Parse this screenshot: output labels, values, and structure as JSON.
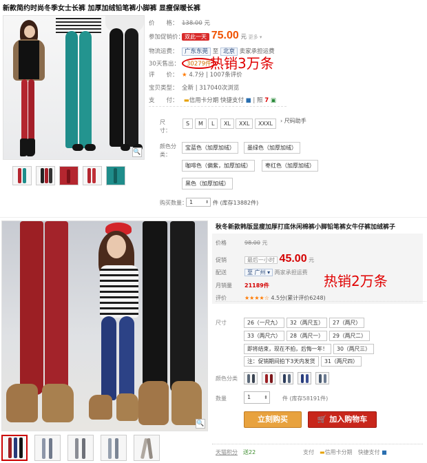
{
  "top": {
    "title": "新款简约时尚冬季女士长裤 加厚加绒铅笔裤小脚裤 显瘦保暖长裤",
    "price_label": "价　　格：",
    "price": "138.00",
    "price_unit": "元",
    "promo_label": "参加促销价：",
    "promo_tag": "双此一天",
    "promo_price": "75.00",
    "promo_unit": "元",
    "promo_more": "更多 ▾",
    "shipping_label": "物流运费：",
    "shipping_from": "广东东莞",
    "shipping_to_word": "至",
    "shipping_to": "北京",
    "shipping_note": "卖家承担运费",
    "sold_label": "30天售出：",
    "sold_count": "30279",
    "sold_unit": "件",
    "rating_label": "评　　价：",
    "rating_score": "4.7分",
    "reviews": "1007条评价",
    "type_label": "宝贝类型：",
    "type_value": "全新",
    "views": "317040次浏览",
    "pay_label": "支　　付：",
    "pay_items": [
      "信用卡分期",
      "快捷支付",
      "照"
    ],
    "size_label": "尺　　寸：",
    "sizes": [
      "S",
      "M",
      "L",
      "XL",
      "XXL",
      "XXXL"
    ],
    "size_chart": "尺码助手",
    "color_label": "颜色分类：",
    "colors": [
      "宝蓝色（加厚加绒）",
      "墨绿色（加厚加绒）",
      "咖啡色（偏紫，加厚加绒）",
      "枣红色（加厚加绒）",
      "黑色（加厚加绒）"
    ],
    "qty_label": "购买数量：",
    "qty_value": "1",
    "qty_unit": "件",
    "stock": "(库存13882件)",
    "hot_note": "热销3万条",
    "zoom_icon": "🔍"
  },
  "bottom": {
    "title": "秋冬新款韩版显瘦加厚打底休闲棉裤小脚铅笔裤女牛仔裤加绒裤子",
    "price_label": "价格",
    "price": "98.00",
    "price_unit": "元",
    "promo_label": "促销",
    "promo_tag": "最后一小时",
    "promo_price": "45.00",
    "promo_unit": "元",
    "ship_label": "配送",
    "ship_from": "至 广州 ▾",
    "ship_note": "两家承担运费",
    "monthly_label": "月销量",
    "monthly_value": "21189件",
    "rating_label": "评价",
    "rating_stars": "★★★★☆",
    "rating_text": "4.5分(累计评价6248)",
    "hot_note": "热销2万条",
    "size_label": "尺寸",
    "sizes": [
      "26（一尺九）",
      "32（两尺五）",
      "27（两尺）",
      "33（两尺六）",
      "28（两尺一）",
      "29（两尺二）",
      "即将结束，现在不拍，后悔一年！",
      "30（两尺三）",
      "注：促销期间拍下3天内发货",
      "31（两尺四）"
    ],
    "color_label": "颜色分类",
    "qty_label": "数量",
    "qty_value": "1",
    "qty_unit": "件",
    "stock": "(库存58191件)",
    "buy_btn": "立刻购买",
    "cart_btn": "加入购物车",
    "footer_left": "天猫积分",
    "footer_points": "送22",
    "footer_pay": "支付",
    "footer_items": [
      "信用卡分期",
      "快捷支付"
    ],
    "zoom_icon": "🔍"
  },
  "colors": {
    "hot_red": "#e00000",
    "price_orange": "#f05300",
    "buy_orange": "#e8a23e",
    "cart_red": "#c8261b"
  }
}
